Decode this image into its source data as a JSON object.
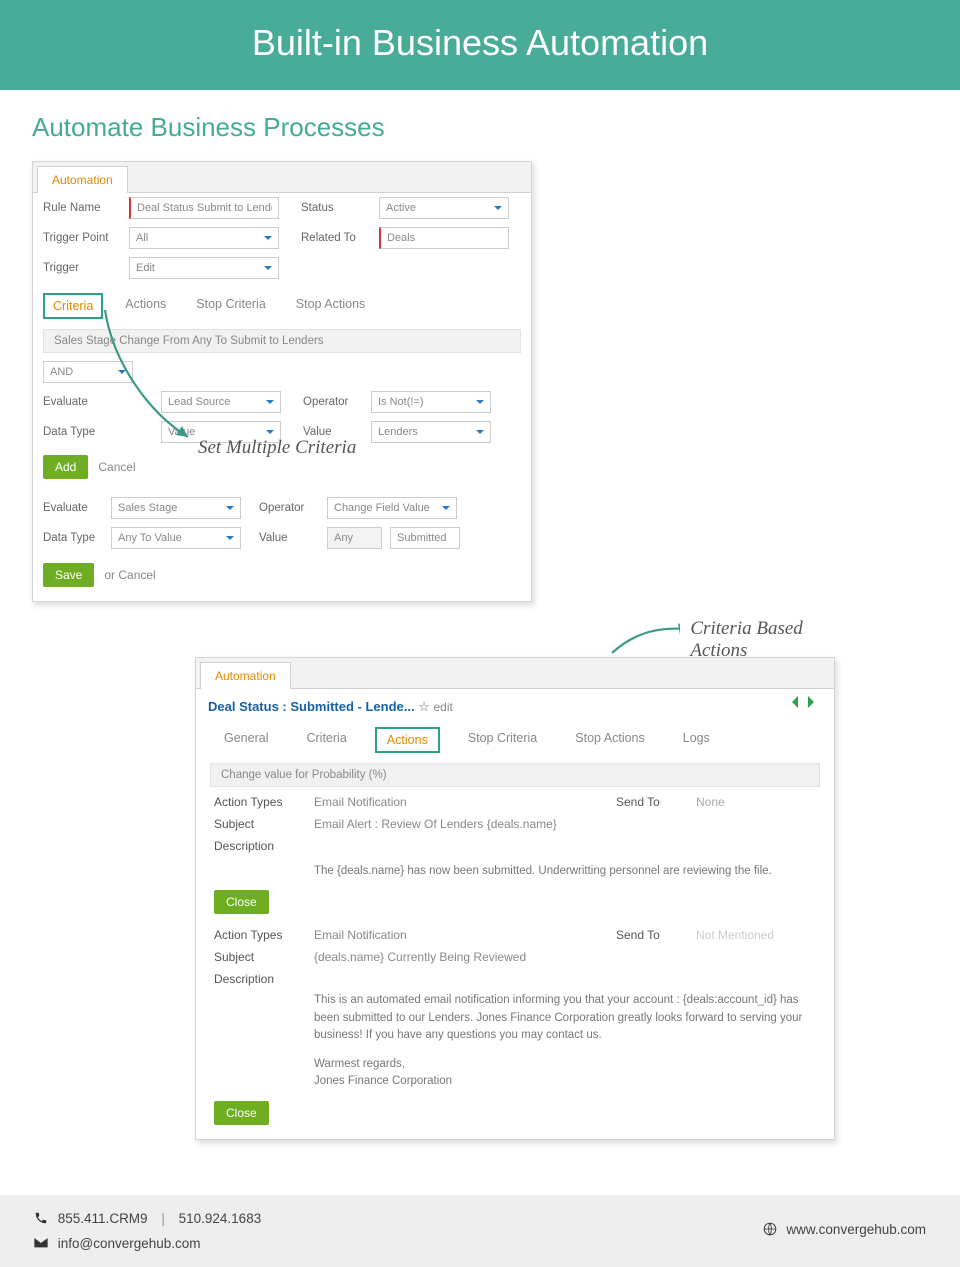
{
  "hero": "Built-in Business Automation",
  "subtitle": "Automate Business Processes",
  "annotations": {
    "a1": "Set Multiple Criteria",
    "a2": "Criteria Based Actions"
  },
  "card1": {
    "tab": "Automation",
    "labels": {
      "rule": "Rule Name",
      "status": "Status",
      "trigp": "Trigger Point",
      "related": "Related To",
      "trigger": "Trigger"
    },
    "values": {
      "rule": "Deal Status Submit to Lenders",
      "status": "Active",
      "trigp": "All",
      "related": "Deals",
      "trigger": "Edit"
    },
    "subtabs": [
      "Criteria",
      "Actions",
      "Stop Criteria",
      "Stop Actions"
    ],
    "gbar": "Sales Stage Change From Any To Submit to Lenders",
    "logic": "AND",
    "block1": {
      "evalLabel": "Evaluate",
      "evalVal": "Lead Source",
      "opLabel": "Operator",
      "opVal": "Is Not(!=)",
      "dtLabel": "Data Type",
      "dtVal": "Value",
      "valLabel": "Value",
      "valVal": "Lenders"
    },
    "addBtn": "Add",
    "cancel": "Cancel",
    "block2": {
      "evalLabel": "Evaluate",
      "evalVal": "Sales Stage",
      "opLabel": "Operator",
      "opVal": "Change Field Value",
      "dtLabel": "Data Type",
      "dtVal": "Any To Value",
      "valLabel": "Value",
      "v1": "Any",
      "v2": "Submitted"
    },
    "saveBtn": "Save",
    "orCancel": "or  Cancel"
  },
  "card2": {
    "tab": "Automation",
    "title": "Deal Status : Submitted - Lende...",
    "edit": "edit",
    "subtabs": [
      "General",
      "Criteria",
      "Actions",
      "Stop Criteria",
      "Stop Actions",
      "Logs"
    ],
    "gbar": "Change value for Probability (%)",
    "sect1": {
      "atLabel": "Action Types",
      "atVal": "Email Notification",
      "stLabel": "Send To",
      "stVal": "None",
      "subjLabel": "Subject",
      "subjVal": "Email Alert : Review Of Lenders {deals.name}",
      "descLabel": "Description",
      "desc": "The {deals.name} has now been submitted. Underwritting personnel are reviewing the file."
    },
    "close": "Close",
    "sect2": {
      "atLabel": "Action Types",
      "atVal": "Email Notification",
      "stLabel": "Send To",
      "stVal": "Not Mentioned",
      "subjLabel": "Subject",
      "subjVal": "{deals.name} Currently Being Reviewed",
      "descLabel": "Description",
      "desc1": "This is an automated email notification informing you that your account : {deals:account_id} has been submitted to our Lenders. Jones Finance Corporation greatly looks forward to serving your business! If you have any questions you may contact us.",
      "desc2": "Warmest regards,",
      "desc3": "Jones Finance Corporation"
    }
  },
  "footer": {
    "phone1": "855.411.CRM9",
    "sep": "|",
    "phone2": "510.924.1683",
    "email": "info@convergehub.com",
    "site": "www.convergehub.com"
  }
}
